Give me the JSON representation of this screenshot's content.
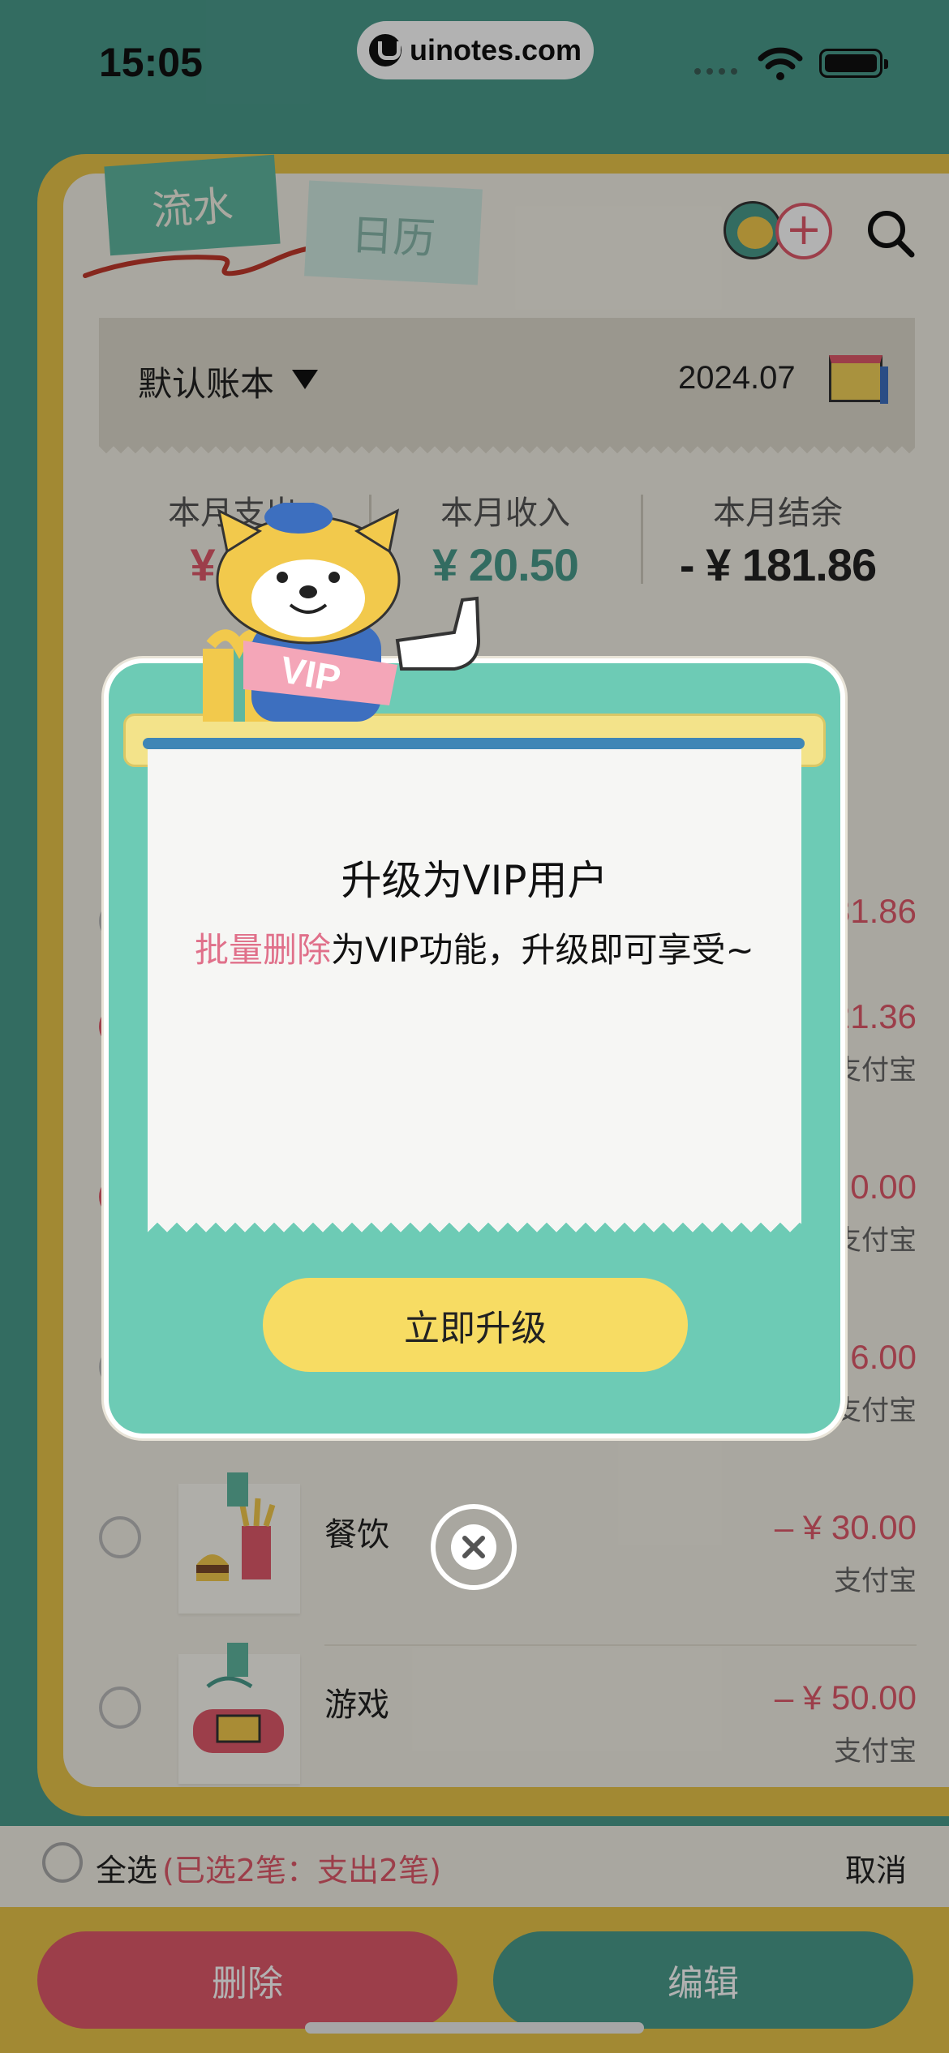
{
  "status_bar": {
    "time": "15:05",
    "watermark": "uinotes.com"
  },
  "header": {
    "tab_active": "流水",
    "tab_inactive": "日历"
  },
  "book_bar": {
    "book_name": "默认账本",
    "month": "2024.07"
  },
  "stats": [
    {
      "label": "本月支出",
      "value": "¥ 20",
      "color": "#e05a6a"
    },
    {
      "label": "本月收入",
      "value": "¥ 20.50",
      "color": "#4a9b8c"
    },
    {
      "label": "本月结余",
      "value": "- ¥ 181.86",
      "color": "#222222"
    }
  ],
  "records": [
    {
      "category": "",
      "amount": "181.86",
      "pay": "",
      "checked": false
    },
    {
      "category": "",
      "amount": "21.36",
      "pay": "支付宝",
      "checked": true
    },
    {
      "category": "",
      "amount": "0.00",
      "pay": "支付宝",
      "checked": true
    },
    {
      "category": "",
      "amount": "6.00",
      "pay": "支付宝",
      "checked": false
    },
    {
      "category": "餐饮",
      "amount": "– ¥ 30.00",
      "pay": "支付宝",
      "checked": false
    },
    {
      "category": "游戏",
      "amount": "– ¥ 50.00",
      "pay": "支付宝",
      "checked": false
    }
  ],
  "selection": {
    "select_all": "全选",
    "info": "(已选2笔：支出2笔)",
    "cancel": "取消"
  },
  "actions": {
    "delete": "删除",
    "edit": "编辑"
  },
  "modal": {
    "badge": "VIP",
    "title": "升级为VIP用户",
    "msg_highlight": "批量删除",
    "msg_rest": "为VIP功能，升级即可享受~",
    "upgrade": "立即升级"
  },
  "colors": {
    "accent_green": "#6dcbb5",
    "accent_red": "#e05a6a",
    "accent_yellow": "#f7dc63"
  }
}
